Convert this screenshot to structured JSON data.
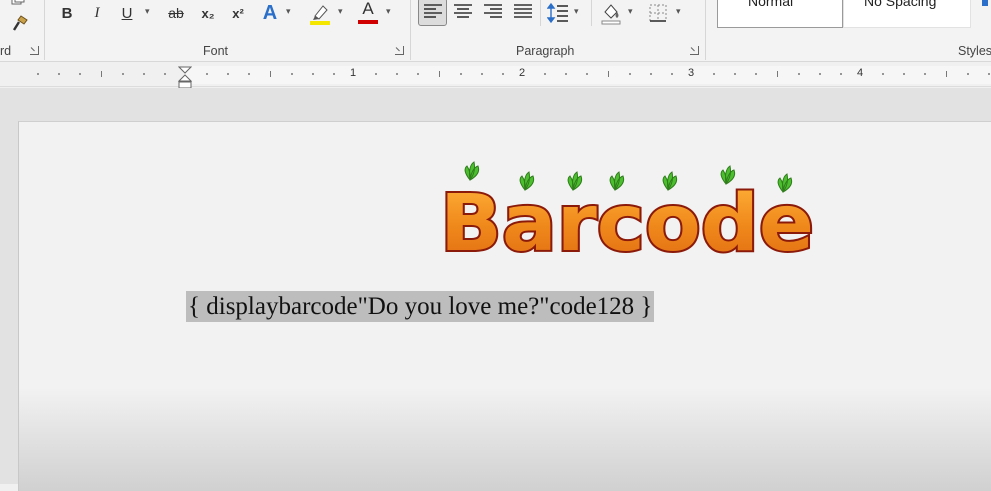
{
  "ribbon": {
    "clipboard_label_partial": "rd",
    "font_group_label": "Font",
    "paragraph_group_label": "Paragraph",
    "styles_group_label": "Styles",
    "buttons": {
      "bold": "B",
      "italic": "I",
      "underline": "U",
      "strikethrough": "ab",
      "subscript": "x₂",
      "superscript": "x²",
      "text_effects": "A",
      "font_color": "A"
    },
    "styles": {
      "normal": "Normal",
      "no_spacing": "No Spacing"
    },
    "colors": {
      "highlight": "#f5e600",
      "font_color": "#d00000",
      "text_effects": "#2a6fc9"
    }
  },
  "ruler": {
    "numbers": [
      "1",
      "2",
      "3",
      "4"
    ]
  },
  "document": {
    "logo_text": "Barcode",
    "field_code": "{ displaybarcode\"Do you love me?\"code128 }"
  }
}
